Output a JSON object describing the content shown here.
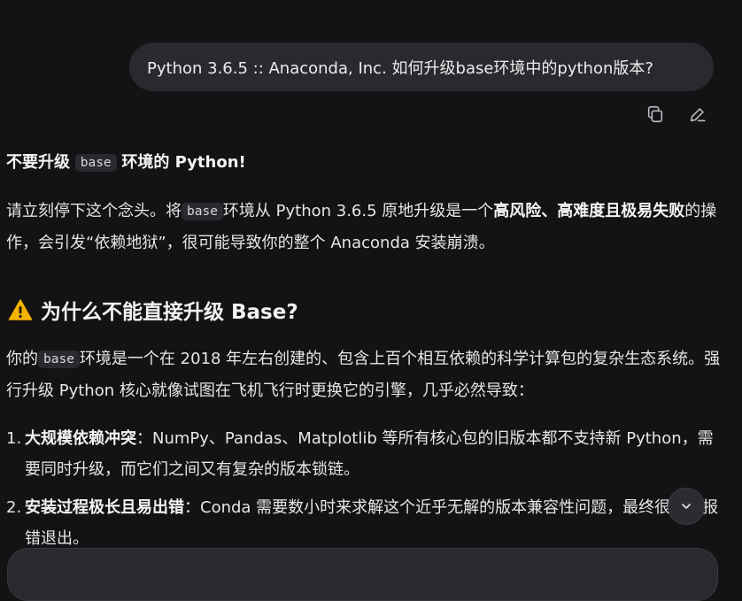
{
  "user_message": {
    "text": "Python 3.6.5 :: Anaconda, Inc. 如何升级base环境中的python版本?"
  },
  "actions": {
    "copy": "copy-icon",
    "edit": "edit-icon"
  },
  "response": {
    "p1": {
      "a": "不要升级",
      "code": "base",
      "b": "环境的 Python!"
    },
    "p2": {
      "a": "请立刻停下这个念头。将",
      "code": "base",
      "b": "环境从 Python 3.6.5 原地升级是一个",
      "bold": "高风险、高难度且极易失败",
      "c": "的操作，会引发“依赖地狱”，很可能导致你的整个 Anaconda 安装崩溃。"
    },
    "heading": "为什么不能直接升级 Base?",
    "p3": {
      "a": "你的",
      "code": "base",
      "b": "环境是一个在 2018 年左右创建的、包含上百个相互依赖的科学计算包的复杂生态系统。强行升级 Python 核心就像试图在飞机飞行时更换它的引擎，几乎必然导致："
    },
    "list": [
      {
        "num": "1.",
        "bold": "大规模依赖冲突",
        "text": "：NumPy、Pandas、Matplotlib 等所有核心包的旧版本都不支持新 Python，需要同时升级，而它们之间又有复杂的版本锁链。"
      },
      {
        "num": "2.",
        "bold": "安装过程极长且易出错",
        "text": "：Conda 需要数小时来求解这个近乎无解的版本兼容性问题，最终很可能报错退出。"
      }
    ]
  },
  "colors": {
    "background": "#131316",
    "bubble": "#2a2a2e",
    "warning": "#f5b400"
  }
}
